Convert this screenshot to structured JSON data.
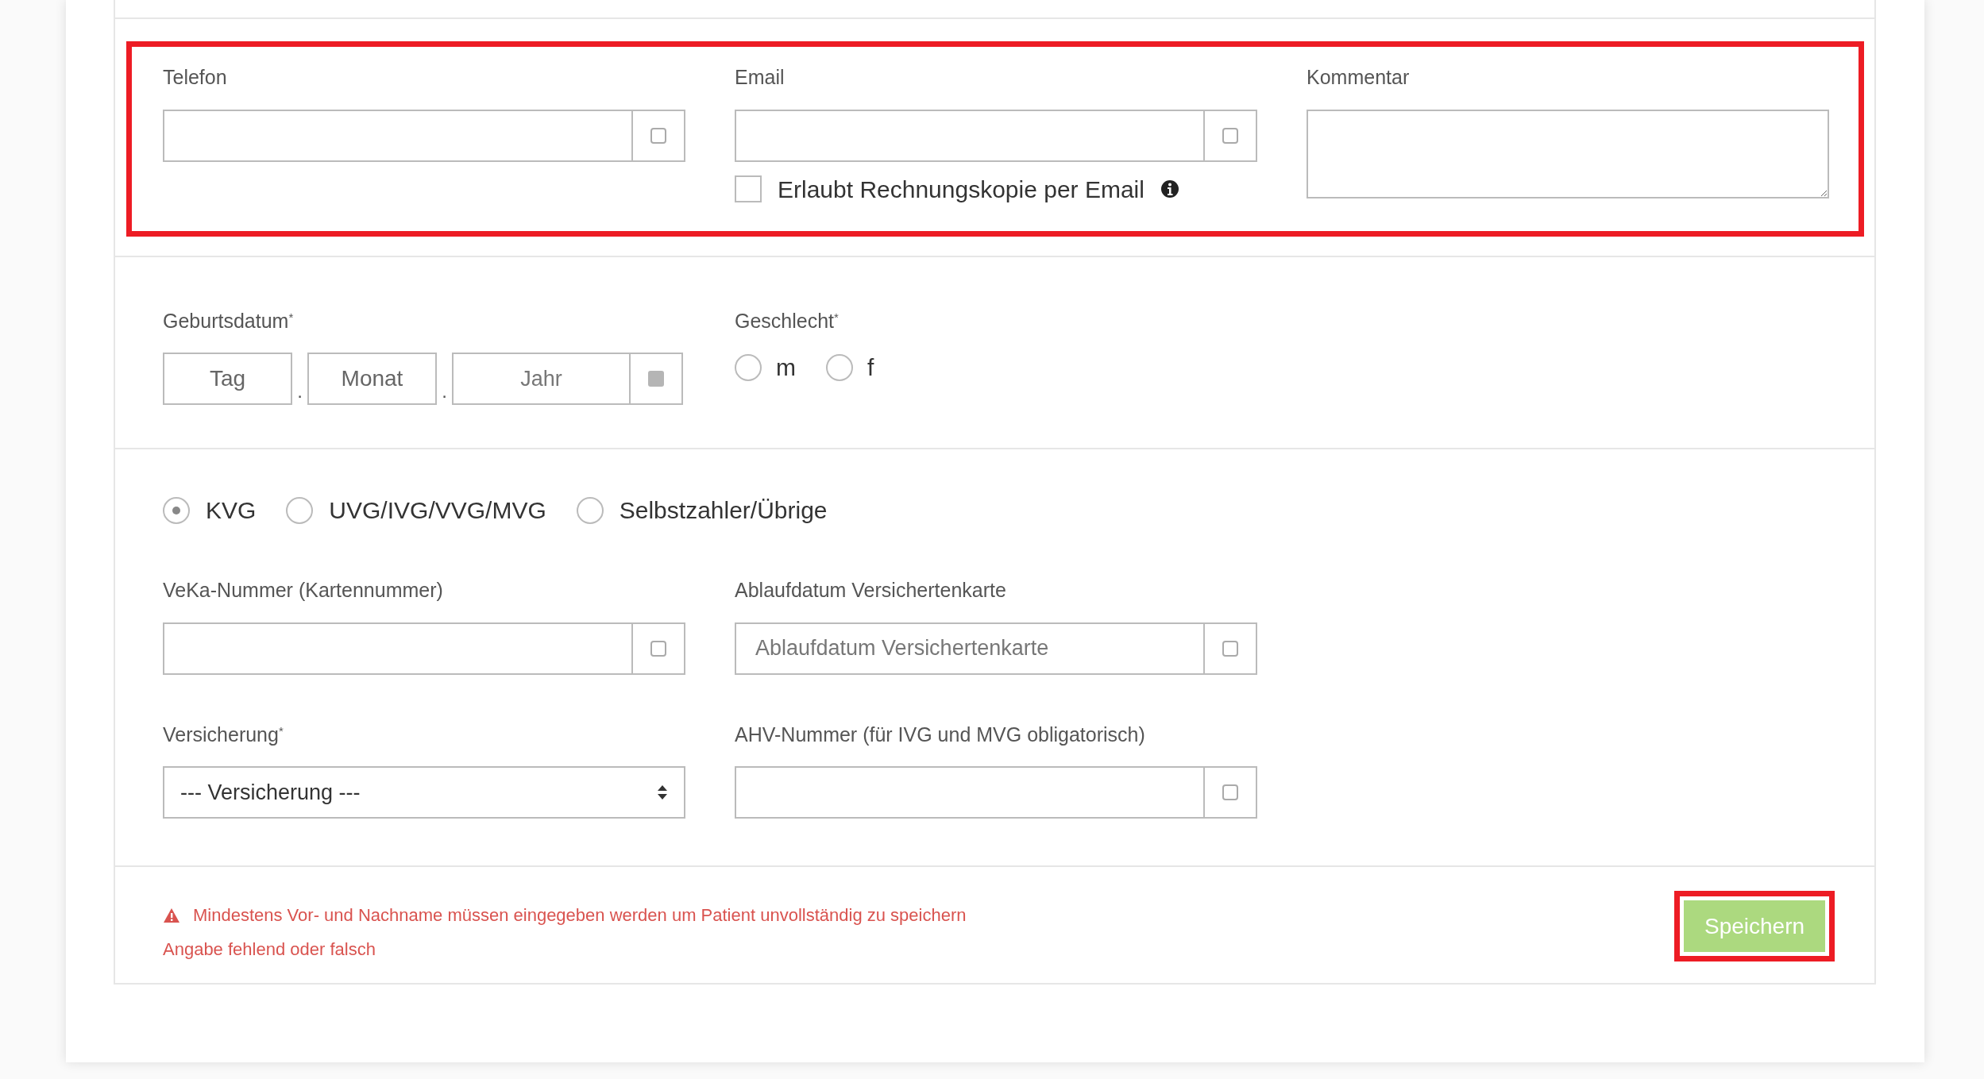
{
  "contact_section": {
    "highlighted": true,
    "telefon": {
      "label": "Telefon"
    },
    "email": {
      "label": "Email",
      "copy_checkbox": {
        "label": "Erlaubt Rechnungskopie per Email",
        "checked": false
      }
    },
    "kommentar": {
      "label": "Kommentar"
    }
  },
  "personal_section": {
    "birthdate": {
      "label": "Geburtsdatum$^{*}$",
      "parts": [
        {
          "placeholder": "Tag"
        },
        {
          "placeholder": "Monat"
        },
        {
          "placeholder": "Jahr"
        }
      ],
      "separators": [
        ".",
        "."
      ]
    },
    "gender": {
      "label": "Geschlecht$^{*}$",
      "options": [
        {
          "label": "m",
          "selected": false
        },
        {
          "label": "f",
          "selected": false
        }
      ]
    }
  },
  "insurance_section": {
    "types": [
      {
        "label": "KVG",
        "selected": true
      },
      {
        "label": "UVG/IVG/VVG/MVG",
        "selected": false
      },
      {
        "label": "Selbstzahler/Übrige",
        "selected": false
      }
    ],
    "fields": [
      {
        "kind": "input",
        "label": "VeKa-Nummer (Kartennummer)"
      },
      {
        "kind": "input",
        "label": "Ablaufdatum Versichertenkarte",
        "placeholder": "Ablaufdatum Versichertenkarte"
      },
      {
        "kind": "select",
        "label": "Versicherung$^{*}$",
        "value": "--- Versicherung ---"
      },
      {
        "kind": "input",
        "label": "AHV-Nummer (für IVG und MVG obligatorisch)"
      }
    ]
  },
  "footer": {
    "warning": "Mindestens Vor- und Nachname müssen eingegeben werden um Patient unvollständig zu speichern",
    "error": "Angabe fehlend oder falsch",
    "save_button": {
      "label": "Speichern",
      "highlighted": true
    }
  }
}
